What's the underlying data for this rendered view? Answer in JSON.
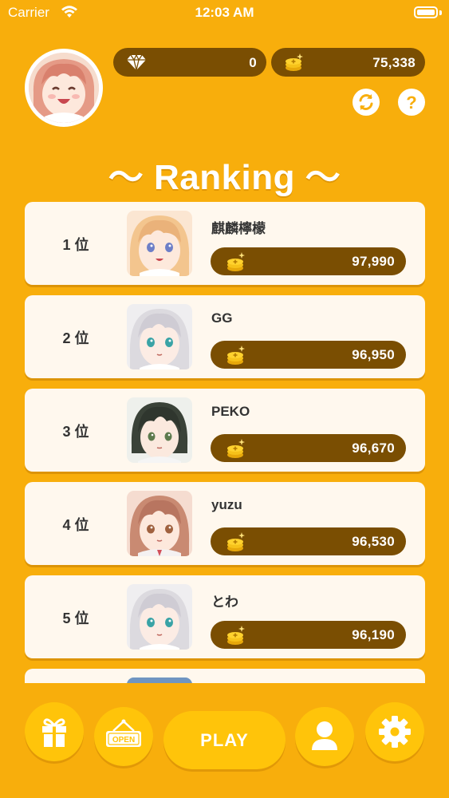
{
  "status_bar": {
    "carrier": "Carrier",
    "time": "12:03 AM"
  },
  "header": {
    "gems": "0",
    "coins": "75,338"
  },
  "title": "～ Ranking ～",
  "ranking": [
    {
      "rank": "1 位",
      "name": "麒麟檸檬",
      "score": "97,990"
    },
    {
      "rank": "2 位",
      "name": "GG",
      "score": "96,950"
    },
    {
      "rank": "3 位",
      "name": "PEKO",
      "score": "96,670"
    },
    {
      "rank": "4 位",
      "name": "yuzu",
      "score": "96,530"
    },
    {
      "rank": "5 位",
      "name": "とわ",
      "score": "96,190"
    },
    {
      "rank": "",
      "name": "",
      "score": ""
    }
  ],
  "bottom_nav": {
    "shop_sign": "OPEN",
    "play_label": "PLAY"
  },
  "colors": {
    "background": "#F8AE0C",
    "pill": "#7A4E02",
    "card": "#FFF8EE",
    "nav_button": "#FFC40A"
  }
}
